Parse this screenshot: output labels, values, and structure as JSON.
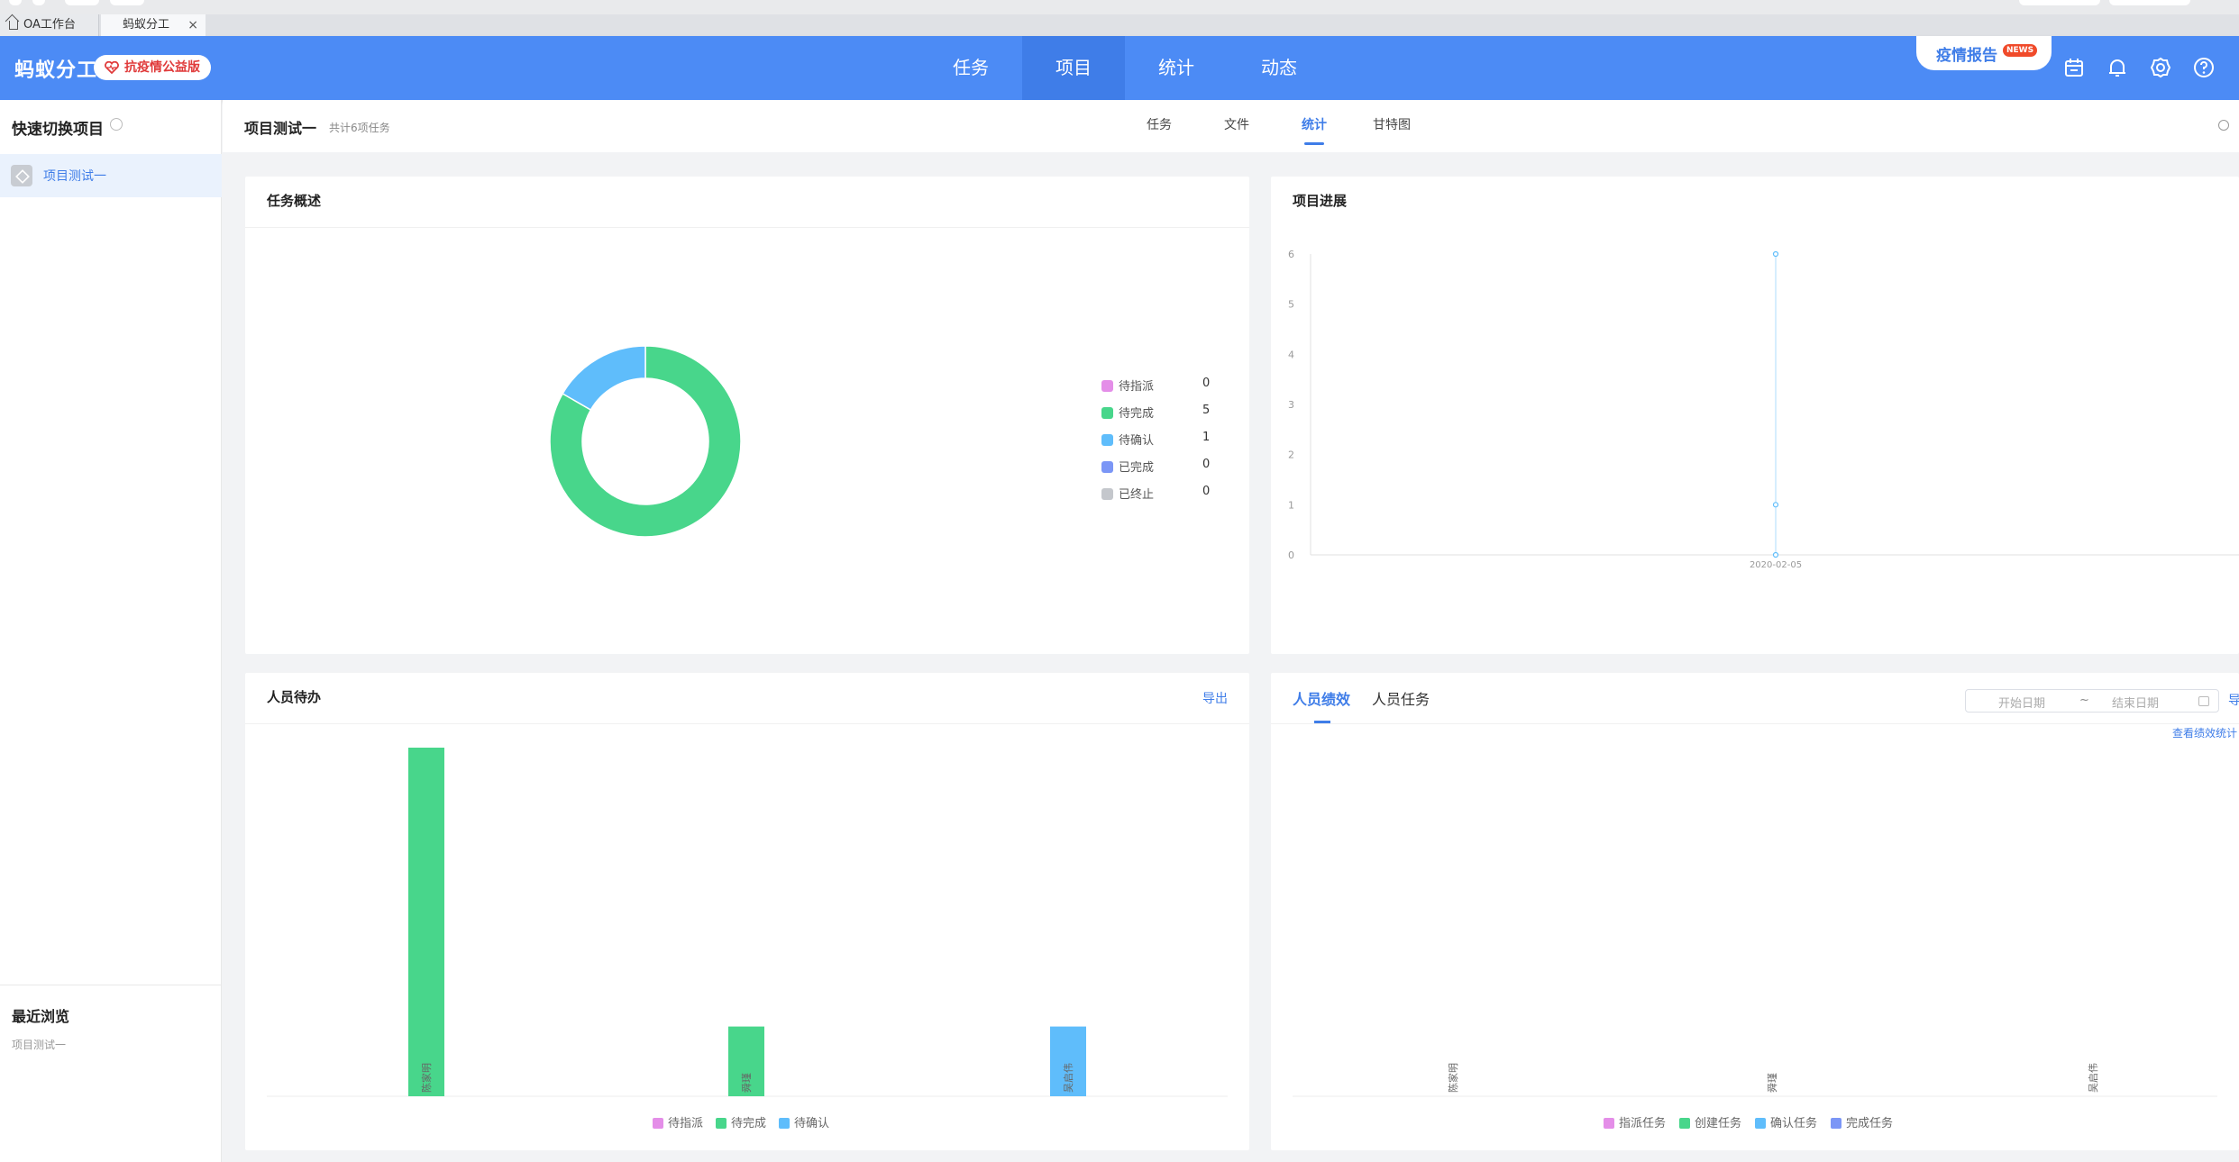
{
  "browser": {
    "tabs": [
      {
        "label": "OA工作台"
      },
      {
        "label": "蚂蚁分工"
      }
    ]
  },
  "header": {
    "logo": "蚂蚁分工",
    "public_badge": "抗疫情公益版",
    "nav": [
      "任务",
      "项目",
      "统计",
      "动态"
    ],
    "active_nav": "项目",
    "report_label": "疫情报告",
    "news_badge": "NEWS",
    "icons": [
      "calendar-icon",
      "bell-icon",
      "gear-icon",
      "help-icon"
    ],
    "colors": {
      "primary": "#4c8bf5",
      "active_nav": "#3f7de8"
    }
  },
  "sidebar": {
    "title": "快速切换项目",
    "items": [
      {
        "label": "项目测试一"
      }
    ],
    "recent_title": "最近浏览",
    "recent_items": [
      {
        "label": "项目测试一"
      }
    ]
  },
  "subbar": {
    "project_name": "项目测试一",
    "task_count": "共计6项任务",
    "tabs": [
      "任务",
      "文件",
      "统计",
      "甘特图"
    ],
    "active_tab": "统计"
  },
  "overview": {
    "title": "任务概述",
    "legend": [
      {
        "name": "待指派",
        "value": "0",
        "color": "#e48ee8"
      },
      {
        "name": "待完成",
        "value": "5",
        "color": "#48d68b"
      },
      {
        "name": "待确认",
        "value": "1",
        "color": "#5fbdfb"
      },
      {
        "name": "已完成",
        "value": "0",
        "color": "#7b96f6"
      },
      {
        "name": "已终止",
        "value": "0",
        "color": "#c4c7cc"
      }
    ]
  },
  "progress": {
    "title": "项目进展"
  },
  "todo": {
    "title": "人员待办",
    "export": "导出"
  },
  "performance": {
    "tabs": [
      "人员绩效",
      "人员任务"
    ],
    "active_tab": "人员绩效",
    "start_placeholder": "开始日期",
    "separator": "~",
    "end_placeholder": "结束日期",
    "export": "导",
    "view_link": "查看绩效统计"
  },
  "chart_data": [
    {
      "type": "pie",
      "title": "任务概述",
      "categories": [
        "待指派",
        "待完成",
        "待确认",
        "已完成",
        "已终止"
      ],
      "values": [
        0,
        5,
        1,
        0,
        0
      ],
      "colors": [
        "#e48ee8",
        "#48d68b",
        "#5fbdfb",
        "#7b96f6",
        "#c4c7cc"
      ],
      "donut": true,
      "legend": "right"
    },
    {
      "type": "line",
      "title": "项目进展",
      "x": [
        "2020-02-05"
      ],
      "series": [
        {
          "values": [
            6
          ]
        },
        {
          "values": [
            1
          ]
        },
        {
          "values": [
            0
          ]
        }
      ],
      "ylim": [
        0,
        6
      ],
      "yticks": [
        0,
        1,
        2,
        3,
        4,
        5,
        6
      ],
      "color": "#5fbdfb"
    },
    {
      "type": "bar",
      "title": "人员待办",
      "categories": [
        "陈家明",
        "舜瑾",
        "吴启伟"
      ],
      "series": [
        {
          "name": "待指派",
          "values": [
            0,
            0,
            0
          ],
          "color": "#e48ee8"
        },
        {
          "name": "待完成",
          "values": [
            5,
            1,
            0
          ],
          "color": "#48d68b"
        },
        {
          "name": "待确认",
          "values": [
            0,
            0,
            1
          ],
          "color": "#5fbdfb"
        }
      ],
      "ylim": [
        0,
        5
      ],
      "legend": "bottom"
    },
    {
      "type": "bar",
      "title": "人员绩效",
      "categories": [
        "陈家明",
        "舜瑾",
        "吴启伟"
      ],
      "series": [
        {
          "name": "指派任务",
          "values": [
            0,
            0,
            0
          ],
          "color": "#e48ee8"
        },
        {
          "name": "创建任务",
          "values": [
            0,
            0,
            0
          ],
          "color": "#48d68b"
        },
        {
          "name": "确认任务",
          "values": [
            0,
            0,
            0
          ],
          "color": "#5fbdfb"
        },
        {
          "name": "完成任务",
          "values": [
            0,
            0,
            0
          ],
          "color": "#7b96f6"
        }
      ],
      "legend": "bottom"
    }
  ]
}
